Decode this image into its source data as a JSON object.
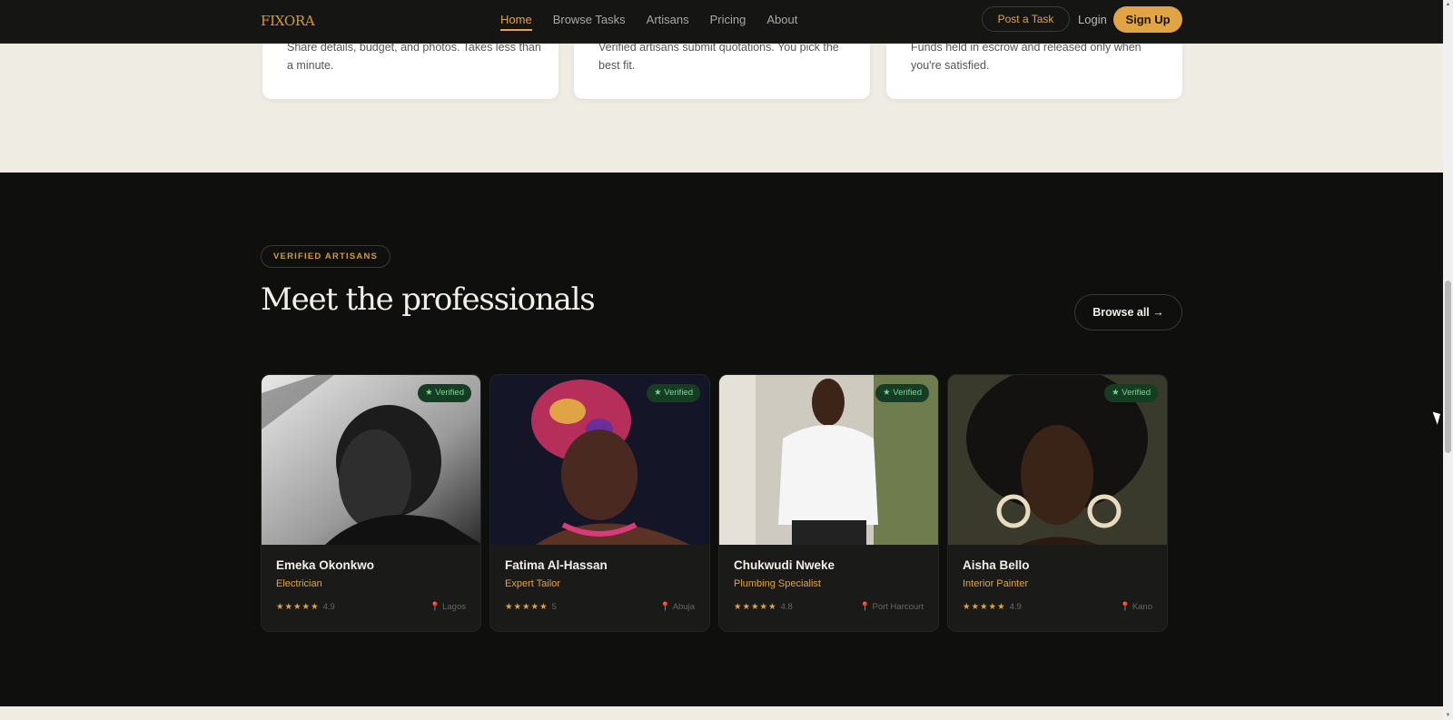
{
  "nav": {
    "logo": "FIXORA",
    "links": [
      "Home",
      "Browse Tasks",
      "Artisans",
      "Pricing",
      "About"
    ],
    "post_task": "Post a Task",
    "login": "Login",
    "signup": "Sign Up"
  },
  "steps": [
    {
      "text": "Share details, budget, and photos. Takes less than a minute."
    },
    {
      "text": "Verified artisans submit quotations. You pick the best fit."
    },
    {
      "text": "Funds held in escrow and released only when you're satisfied."
    }
  ],
  "section": {
    "eyebrow": "VERIFIED ARTISANS",
    "title": "Meet the professionals",
    "browse_all": "Browse all →"
  },
  "artisans": [
    {
      "name": "Emeka Okonkwo",
      "role": "Electrician",
      "stars": "★★★★★",
      "rating": "4.9",
      "location": "Lagos",
      "badge": "★ Verified"
    },
    {
      "name": "Fatima Al-Hassan",
      "role": "Expert Tailor",
      "stars": "★★★★★",
      "rating": "5",
      "location": "Abuja",
      "badge": "★ Verified"
    },
    {
      "name": "Chukwudi Nweke",
      "role": "Plumbing Specialist",
      "stars": "★★★★★",
      "rating": "4.8",
      "location": "Port Harcourt",
      "badge": "★ Verified"
    },
    {
      "name": "Aisha Bello",
      "role": "Interior Painter",
      "stars": "★★★★★",
      "rating": "4.9",
      "location": "Kano",
      "badge": "★ Verified"
    }
  ],
  "icons": {
    "pin": "location-pin-icon",
    "star": "star-icon"
  },
  "colors": {
    "accent": "#e0a445",
    "dark_bg": "#0f0f0d",
    "light_bg": "#efece3",
    "verified": "#6fdc8f"
  }
}
